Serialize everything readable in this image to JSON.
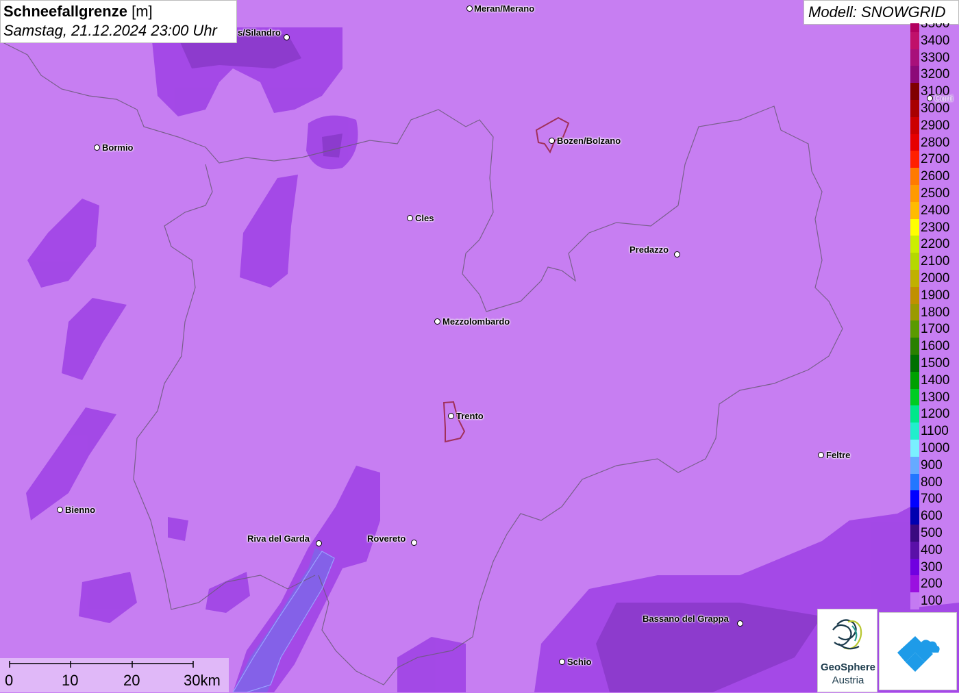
{
  "header": {
    "title_bold": "Schneefallgrenze",
    "title_unit": "[m]",
    "datetime": "Samstag, 21.12.2024 23:00 Uhr",
    "model": "Modell: SNOWGRID"
  },
  "legend": {
    "items": [
      {
        "label": "3500",
        "color": "#b3005f"
      },
      {
        "label": "3400",
        "color": "#c0106a"
      },
      {
        "label": "3300",
        "color": "#a8107a"
      },
      {
        "label": "3200",
        "color": "#8c0a78"
      },
      {
        "label": "3100",
        "color": "#800000"
      },
      {
        "label": "3000",
        "color": "#a80000"
      },
      {
        "label": "2900",
        "color": "#cc0000"
      },
      {
        "label": "2800",
        "color": "#e60000"
      },
      {
        "label": "2700",
        "color": "#ff2000"
      },
      {
        "label": "2600",
        "color": "#ff7a00"
      },
      {
        "label": "2500",
        "color": "#ff9a00"
      },
      {
        "label": "2400",
        "color": "#ffbb00"
      },
      {
        "label": "2300",
        "color": "#ffff00"
      },
      {
        "label": "2200",
        "color": "#ccee00"
      },
      {
        "label": "2100",
        "color": "#b5d800"
      },
      {
        "label": "2000",
        "color": "#c0b000"
      },
      {
        "label": "1900",
        "color": "#c09000"
      },
      {
        "label": "1800",
        "color": "#9a9a00"
      },
      {
        "label": "1700",
        "color": "#5a9a00"
      },
      {
        "label": "1600",
        "color": "#2a8000"
      },
      {
        "label": "1500",
        "color": "#007000"
      },
      {
        "label": "1400",
        "color": "#00a000"
      },
      {
        "label": "1300",
        "color": "#00cc22"
      },
      {
        "label": "1200",
        "color": "#00e88a"
      },
      {
        "label": "1100",
        "color": "#22eecc"
      },
      {
        "label": "1000",
        "color": "#7af0ff"
      },
      {
        "label": "900",
        "color": "#66aaff"
      },
      {
        "label": "800",
        "color": "#2277ff"
      },
      {
        "label": "700",
        "color": "#0000ff"
      },
      {
        "label": "600",
        "color": "#0000b0"
      },
      {
        "label": "500",
        "color": "#3a0a80"
      },
      {
        "label": "400",
        "color": "#5a10a8"
      },
      {
        "label": "300",
        "color": "#7000e0"
      },
      {
        "label": "200",
        "color": "#9a10e0"
      },
      {
        "label": "100",
        "color": "#c47af2"
      }
    ]
  },
  "cities": [
    {
      "name": "Meran/Merano"
    },
    {
      "name": "s/Silandro"
    },
    {
      "name": "Bormio"
    },
    {
      "name": "Bozen/Bolzano"
    },
    {
      "name": "Cles"
    },
    {
      "name": "Predazzo"
    },
    {
      "name": "Mezzolombardo"
    },
    {
      "name": "Trento"
    },
    {
      "name": "Feltre"
    },
    {
      "name": "Bienno"
    },
    {
      "name": "Riva del Garda"
    },
    {
      "name": "Rovereto"
    },
    {
      "name": "Bassano del Grappa"
    },
    {
      "name": "Schio"
    },
    {
      "name": "Corti"
    }
  ],
  "scalebar": {
    "labels": [
      "0",
      "10",
      "20",
      "30km"
    ]
  },
  "logo": {
    "line1": "GeoSphere",
    "line2": "Austria"
  },
  "colors": {
    "base_field": "#c77ef2",
    "low_field": "#9b3fe0",
    "lake": "#6a6fe8"
  }
}
